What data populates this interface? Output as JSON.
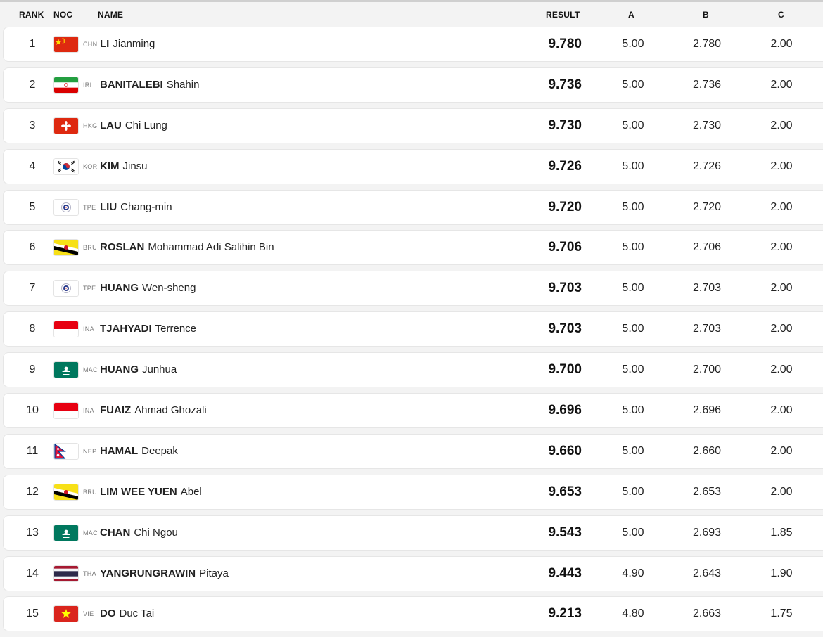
{
  "header": {
    "rank": "RANK",
    "noc": "NOC",
    "name": "NAME",
    "result": "RESULT",
    "a": "A",
    "b": "B",
    "c": "C"
  },
  "rows": [
    {
      "rank": "1",
      "noc": "CHN",
      "flag": "flag-chn-icon",
      "surname": "LI",
      "given": "Jianming",
      "result": "9.780",
      "a": "5.00",
      "b": "2.780",
      "c": "2.00"
    },
    {
      "rank": "2",
      "noc": "IRI",
      "flag": "flag-iri-icon",
      "surname": "BANITALEBI",
      "given": "Shahin",
      "result": "9.736",
      "a": "5.00",
      "b": "2.736",
      "c": "2.00"
    },
    {
      "rank": "3",
      "noc": "HKG",
      "flag": "flag-hkg-icon",
      "surname": "LAU",
      "given": "Chi Lung",
      "result": "9.730",
      "a": "5.00",
      "b": "2.730",
      "c": "2.00"
    },
    {
      "rank": "4",
      "noc": "KOR",
      "flag": "flag-kor-icon",
      "surname": "KIM",
      "given": "Jinsu",
      "result": "9.726",
      "a": "5.00",
      "b": "2.726",
      "c": "2.00"
    },
    {
      "rank": "5",
      "noc": "TPE",
      "flag": "flag-tpe-icon",
      "surname": "LIU",
      "given": "Chang-min",
      "result": "9.720",
      "a": "5.00",
      "b": "2.720",
      "c": "2.00"
    },
    {
      "rank": "6",
      "noc": "BRU",
      "flag": "flag-bru-icon",
      "surname": "ROSLAN",
      "given": "Mohammad Adi Salihin Bin",
      "result": "9.706",
      "a": "5.00",
      "b": "2.706",
      "c": "2.00"
    },
    {
      "rank": "7",
      "noc": "TPE",
      "flag": "flag-tpe-icon",
      "surname": "HUANG",
      "given": "Wen-sheng",
      "result": "9.703",
      "a": "5.00",
      "b": "2.703",
      "c": "2.00"
    },
    {
      "rank": "8",
      "noc": "INA",
      "flag": "flag-ina-icon",
      "surname": "TJAHYADI",
      "given": "Terrence",
      "result": "9.703",
      "a": "5.00",
      "b": "2.703",
      "c": "2.00"
    },
    {
      "rank": "9",
      "noc": "MAC",
      "flag": "flag-mac-icon",
      "surname": "HUANG",
      "given": "Junhua",
      "result": "9.700",
      "a": "5.00",
      "b": "2.700",
      "c": "2.00"
    },
    {
      "rank": "10",
      "noc": "INA",
      "flag": "flag-ina-icon",
      "surname": "FUAIZ",
      "given": "Ahmad Ghozali",
      "result": "9.696",
      "a": "5.00",
      "b": "2.696",
      "c": "2.00"
    },
    {
      "rank": "11",
      "noc": "NEP",
      "flag": "flag-nep-icon",
      "surname": "HAMAL",
      "given": "Deepak",
      "result": "9.660",
      "a": "5.00",
      "b": "2.660",
      "c": "2.00"
    },
    {
      "rank": "12",
      "noc": "BRU",
      "flag": "flag-bru-icon",
      "surname": "LIM WEE YUEN",
      "given": "Abel",
      "result": "9.653",
      "a": "5.00",
      "b": "2.653",
      "c": "2.00"
    },
    {
      "rank": "13",
      "noc": "MAC",
      "flag": "flag-mac-icon",
      "surname": "CHAN",
      "given": "Chi Ngou",
      "result": "9.543",
      "a": "5.00",
      "b": "2.693",
      "c": "1.85"
    },
    {
      "rank": "14",
      "noc": "THA",
      "flag": "flag-tha-icon",
      "surname": "YANGRUNGRAWIN",
      "given": "Pitaya",
      "result": "9.443",
      "a": "4.90",
      "b": "2.643",
      "c": "1.90"
    },
    {
      "rank": "15",
      "noc": "VIE",
      "flag": "flag-vie-icon",
      "surname": "DO",
      "given": "Duc Tai",
      "result": "9.213",
      "a": "4.80",
      "b": "2.663",
      "c": "1.75"
    }
  ]
}
